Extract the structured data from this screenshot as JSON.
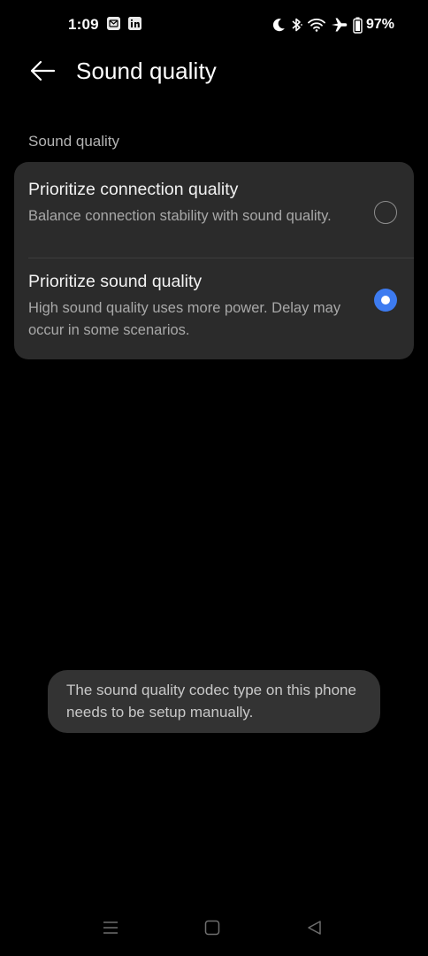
{
  "status_bar": {
    "time": "1:09",
    "battery_percent": "97%",
    "notification_icons": [
      "mail-icon",
      "linkedin-icon"
    ],
    "system_icons": [
      "moon-icon",
      "bluetooth-icon",
      "wifi-icon",
      "airplane-icon",
      "battery-icon"
    ]
  },
  "header": {
    "title": "Sound quality",
    "back_icon": "back-arrow-icon"
  },
  "section": {
    "label": "Sound quality"
  },
  "options": [
    {
      "title": "Prioritize connection quality",
      "description": "Balance connection stability with sound quality.",
      "selected": false
    },
    {
      "title": "Prioritize sound quality",
      "description": "High sound quality uses more power. Delay may occur in some scenarios.",
      "selected": true
    }
  ],
  "toast": {
    "message": "The sound quality codec type on this phone needs to be setup manually."
  },
  "nav_bar": {
    "buttons": [
      "recents-icon",
      "home-icon",
      "back-triangle-icon"
    ]
  },
  "colors": {
    "background": "#000000",
    "card": "#2b2b2b",
    "accent": "#3d7bf0",
    "toast": "#333333"
  }
}
